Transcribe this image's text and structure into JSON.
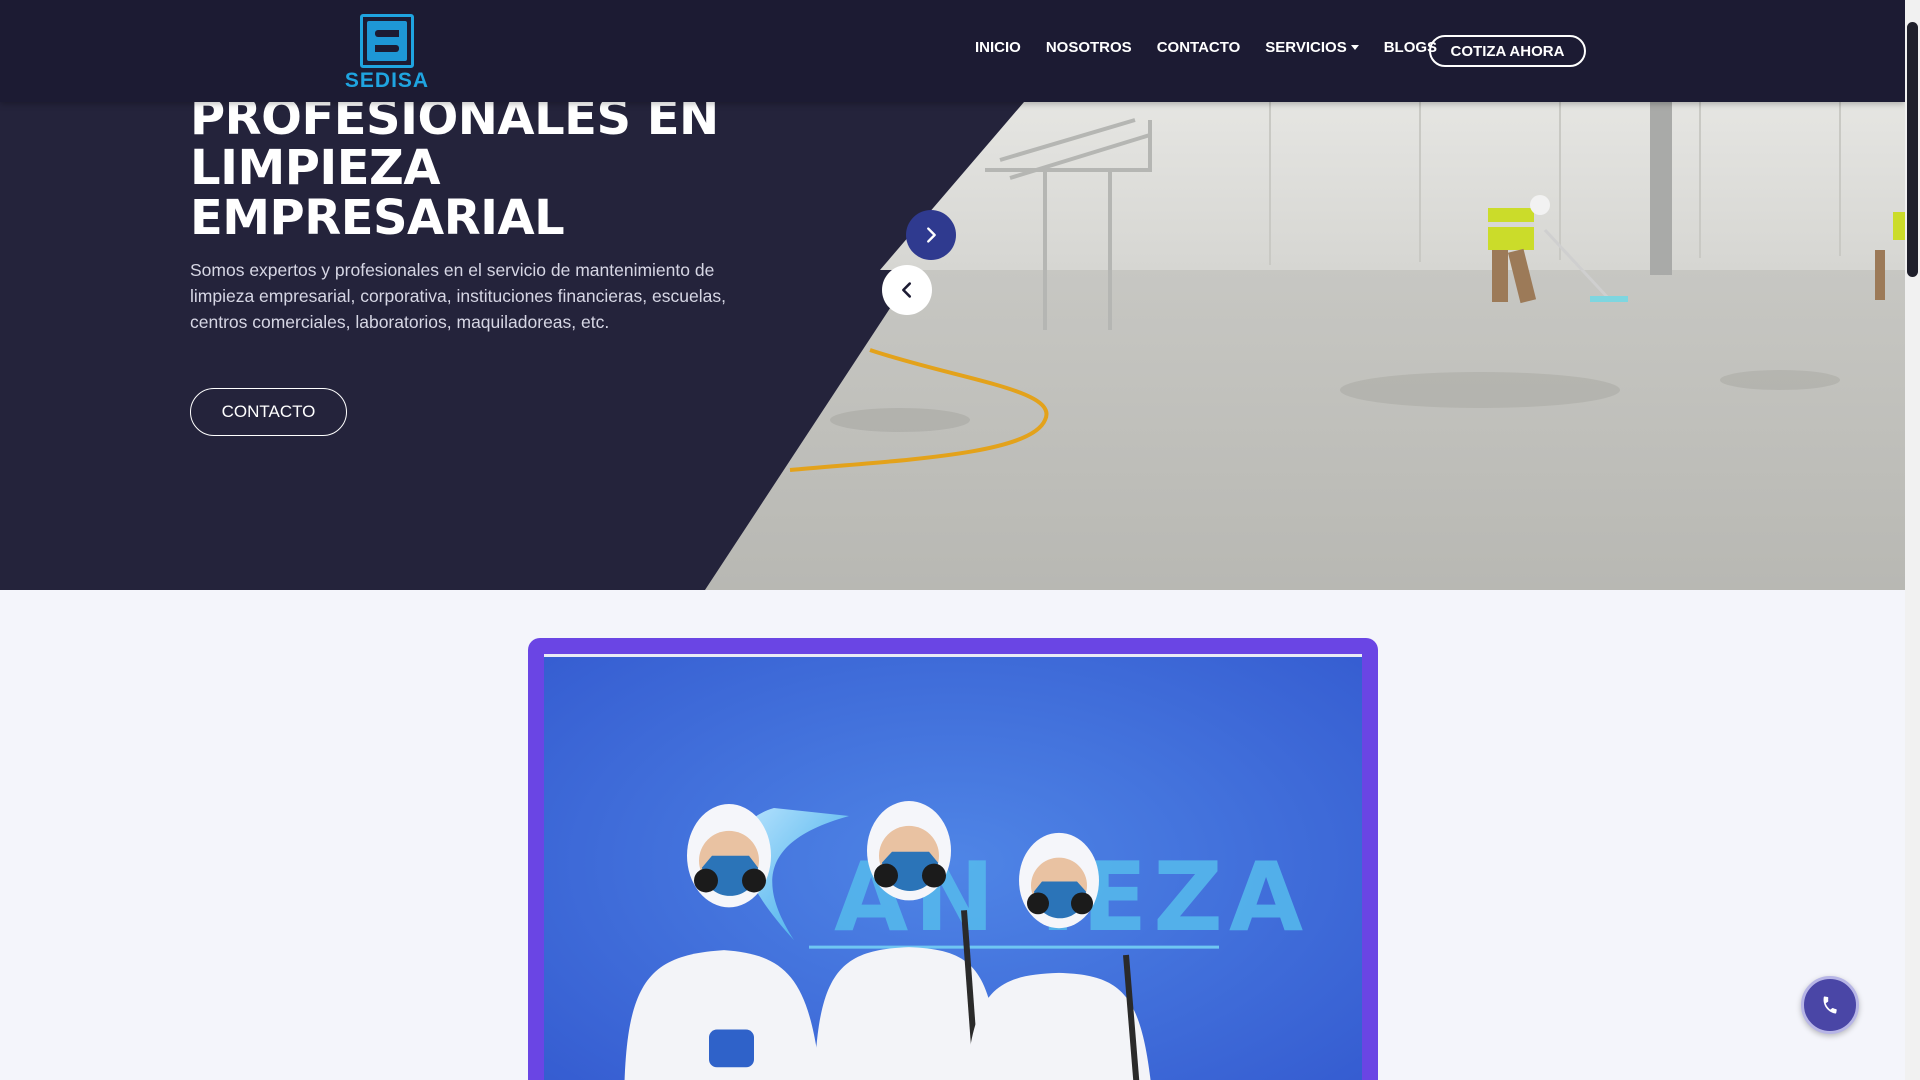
{
  "brand": {
    "name": "SEDISA"
  },
  "nav": {
    "items": [
      {
        "label": "INICIO"
      },
      {
        "label": "NOSOTROS"
      },
      {
        "label": "CONTACTO"
      },
      {
        "label": "SERVICIOS",
        "dropdown": true
      },
      {
        "label": "BLOGS"
      }
    ],
    "cta": "COTIZA AHORA"
  },
  "hero": {
    "title_lines": [
      "PROFESIONALES EN",
      "LIMPIEZA",
      "EMPRESARIAL"
    ],
    "description": "Somos expertos y profesionales en el servicio de mantenimiento de limpieza empresarial, corporativa, instituciones financieras, escuelas, centros comerciales, laboratorios, maquiladoreas, etc.",
    "button": "CONTACTO",
    "icons": {
      "next": "chevron-right-icon",
      "prev": "chevron-left-icon"
    }
  },
  "video": {
    "overlay_text": "AN IEZA"
  },
  "floating": {
    "icon": "phone-icon"
  },
  "colors": {
    "navbar": "#1c1b33",
    "hero_bg": "#24233b",
    "accent_purple": "#6a45e4",
    "arrow_blue": "#2f3a8f",
    "logo_blue": "#1fa4e0",
    "page_bg": "#f4f5fb"
  }
}
